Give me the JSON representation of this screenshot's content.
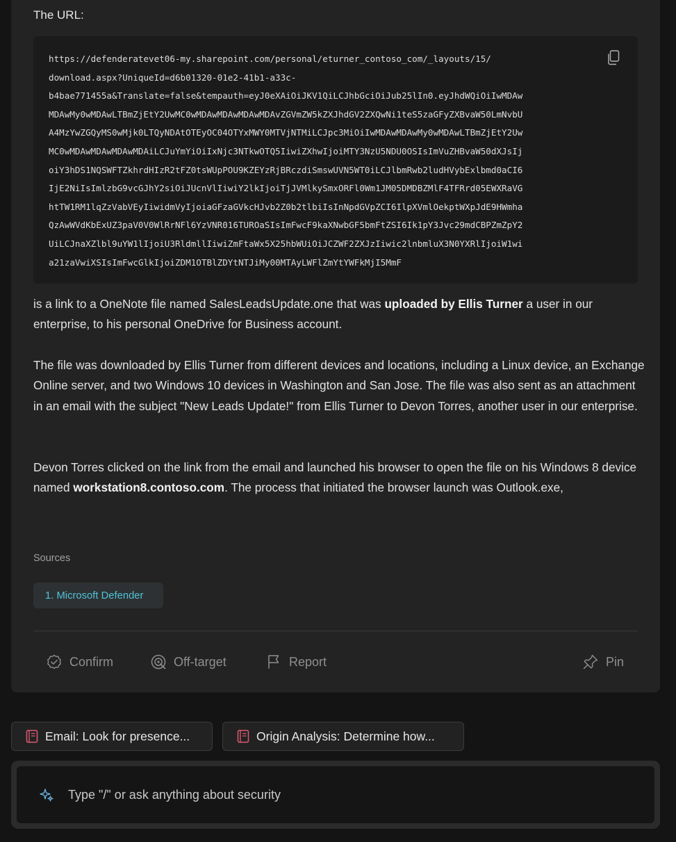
{
  "response": {
    "heading": "The URL:",
    "code_lines": [
      "https://defenderatevet06-my.sharepoint.com/personal/eturner_contoso_com/_layouts/15/",
      "download.aspx?UniqueId=d6b01320-01e2-41b1-a33c-",
      "b4bae771455a&Translate=false&tempauth=eyJ0eXAiOiJKV1QiLCJhbGciOiJub25lIn0.eyJhdWQiOiIwMDAw",
      "MDAwMy0wMDAwLTBmZjEtY2UwMC0wMDAwMDAwMDAwMDAvZGVmZW5kZXJhdGV2ZXQwNi1teS5zaGFyZXBvaW50LmNvbU",
      "A4MzYwZGQyMS0wMjk0LTQyNDAtOTEyOC04OTYxMWY0MTVjNTMiLCJpc3MiOiIwMDAwMDAwMy0wMDAwLTBmZjEtY2Uw",
      "MC0wMDAwMDAwMDAwMDAiLCJuYmYiOiIxNjc3NTkwOTQ5IiwiZXhwIjoiMTY3NzU5NDU0OSIsImVuZHBvaW50dXJsIj",
      "oiY3hDS1NQSWFTZkhrdHIzR2tFZ0tsWUpPOU9KZEYzRjBRczdiSmswUVN5WT0iLCJlbmRwb2ludHVybExlbmd0aCI6",
      "IjE2NiIsImlzbG9vcGJhY2siOiJUcnVlIiwiY2lkIjoiTjJVMlkySmxORFl0Wm1JM05DMDBZMlF4TFRrd05EWXRaVG",
      "htTW1RM1lqZzVabVEyIiwidmVyIjoiaGFzaGVkcHJvb2Z0b2tlbiIsInNpdGVpZCI6IlpXVmlOekptWXpJdE9HWmha",
      "QzAwWVdKbExUZ3paV0V0WlRrNFl6YzVNR016TUROaSIsImFwcF9kaXNwbGF5bmFtZSI6Ik1pY3Jvc29mdCBPZmZpY2",
      "UiLCJnaXZlbl9uYW1lIjoiU3RldmllIiwiZmFtaWx5X25hbWUiOiJCZWF2ZXJzIiwic2lnbmluX3N0YXRlIjoiW1wi",
      "a21zaVwiXSIsImFwcGlkIjoiZDM1OTBlZDYtNTJiMy00MTAyLWFlZmYtYWFkMjI5MmF"
    ],
    "para1": {
      "pre": "is a link to a OneNote file named SalesLeadsUpdate.one that was ",
      "bold": "uploaded by Ellis Turner",
      "post": " a user in our enterprise, to his personal OneDrive for Business account."
    },
    "para2": "The file was downloaded by Ellis Turner from different devices and locations, including a Linux device, an Exchange Online server, and two Windows 10 devices in Washington and San Jose. The file was also sent as an attachment in an email with the subject \"New Leads Update!\" from Ellis Turner to Devon Torres, another user in our enterprise.",
    "para3": {
      "pre": "Devon Torres clicked on the link from the email and launched his browser to open the file on his Windows 8 device named ",
      "bold": "workstation8.contoso.com",
      "post": ". The process that initiated the browser launch was Outlook.exe,"
    },
    "sources_label": "Sources",
    "sources": [
      "1. Microsoft Defender"
    ],
    "actions": {
      "confirm": "Confirm",
      "off_target": "Off-target",
      "report": "Report",
      "pin": "Pin"
    }
  },
  "prompt_suggestions": [
    "Email: Look for presence...",
    "Origin Analysis: Determine how..."
  ],
  "input": {
    "placeholder": "Type \"/\" or ask anything about security",
    "value": ""
  },
  "colors": {
    "accent": "#4fc3d9",
    "background": "#141414",
    "card": "#232323"
  }
}
